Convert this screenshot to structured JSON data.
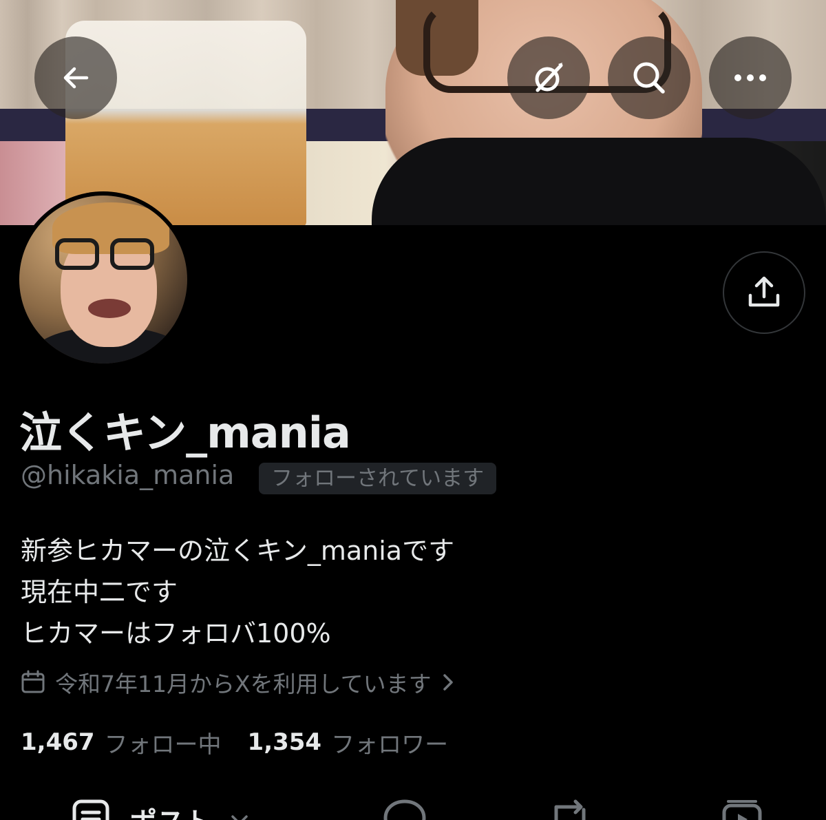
{
  "header": {
    "back_icon": "arrow-left-icon",
    "grok_icon": "grok-icon",
    "search_icon": "search-icon",
    "more_icon": "more-horizontal-icon"
  },
  "profile": {
    "display_name": "泣くキン_mania",
    "handle": "@hikakia_mania",
    "follows_you_badge": "フォローされています",
    "bio_lines": [
      "新参ヒカマーの泣くキン_maniaです",
      "現在中二です",
      "ヒカマーはフォロバ100%"
    ],
    "joined": "令和7年11月からXを利用しています",
    "following_count": "1,467",
    "following_label": "フォロー中",
    "followers_count": "1,354",
    "followers_label": "フォロワー"
  },
  "share": {
    "icon": "share-icon"
  },
  "tabs": [
    {
      "label": "ポスト",
      "icon": "posts-icon"
    },
    {
      "label": "",
      "icon": "reply-bubble-icon"
    },
    {
      "label": "",
      "icon": "repost-icon"
    },
    {
      "label": "",
      "icon": "media-play-icon"
    }
  ],
  "colors": {
    "background": "#000000",
    "primary_text": "#e7e9ea",
    "secondary_text": "#71767b",
    "badge_bg": "#202327",
    "border": "#333639"
  }
}
